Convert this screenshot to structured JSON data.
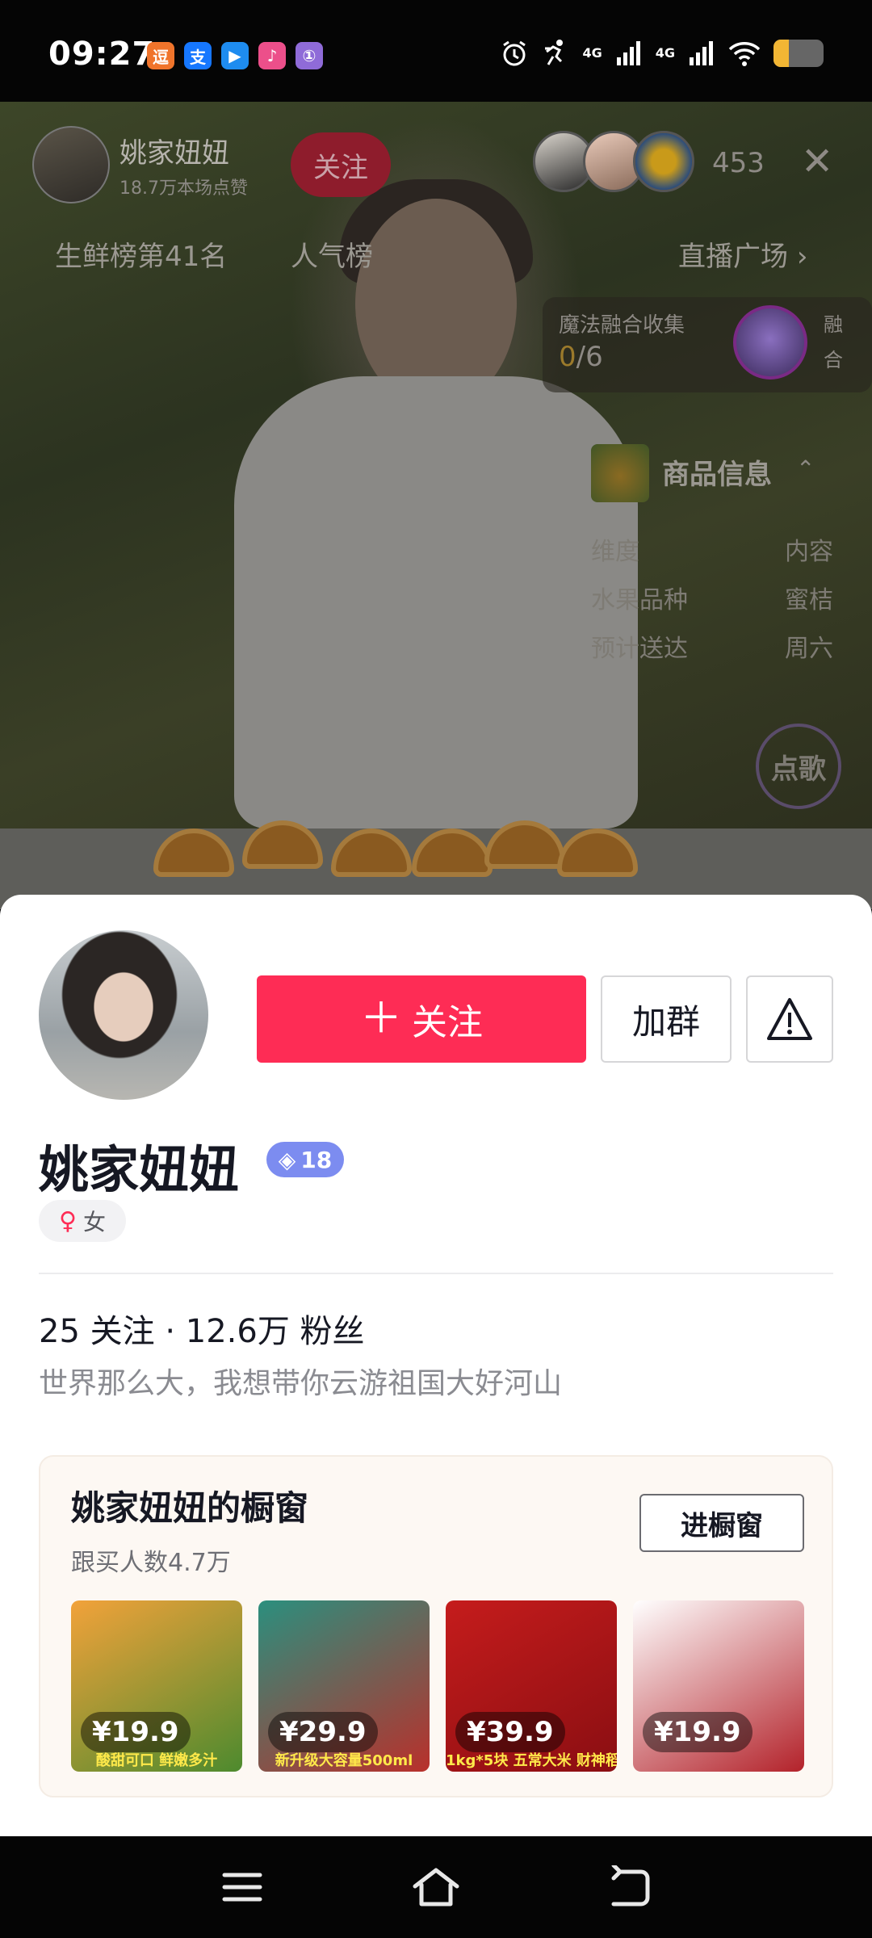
{
  "status_bar": {
    "time": "09:27",
    "notifications": [
      {
        "icon": "app-notification-icon",
        "glyph": "逗",
        "color": "#f0742b"
      },
      {
        "icon": "alipay-icon",
        "glyph": "支",
        "color": "#1677ff"
      },
      {
        "icon": "video-app-icon",
        "glyph": "▶",
        "color": "#1e8cf0"
      },
      {
        "icon": "music-app-icon",
        "glyph": "♪",
        "color": "#ec4f8a"
      },
      {
        "icon": "app-icon",
        "glyph": "①",
        "color": "#8f6bd8"
      }
    ],
    "network_1": "4G",
    "network_2": "4G",
    "battery_level": 0.3
  },
  "live": {
    "host_name": "姚家妞妞",
    "host_likes": "18.7万本场点赞",
    "follow_label": "关注",
    "viewer_count": "453",
    "rank_label": "生鲜榜第41名",
    "popularity_label": "人气榜",
    "plaza_label": "直播广场",
    "magic": {
      "title": "魔法融合收集",
      "current": "0",
      "total": "/6",
      "side_label": "融合"
    },
    "product": {
      "title": "商品信息",
      "rows": [
        {
          "key": "维度",
          "value": "内容"
        },
        {
          "key": "水果品种",
          "value": "蜜桔"
        },
        {
          "key": "预计送达",
          "value": "周六"
        }
      ]
    },
    "song_label": "点歌"
  },
  "profile": {
    "follow_button": "关注",
    "group_button": "加群",
    "name": "姚家妞妞",
    "level": "18",
    "gender": "女",
    "stats": "25 关注 · 12.6万 粉丝",
    "bio": "世界那么大，我想带你云游祖国大好河山"
  },
  "window": {
    "title": "姚家妞妞的橱窗",
    "subtitle": "跟买人数4.7万",
    "enter_button": "进橱窗",
    "goods": [
      {
        "price": "¥19.9",
        "caption": "酸甜可口 鲜嫩多汁",
        "colors": [
          "#f2a23a",
          "#4d8a2e"
        ]
      },
      {
        "price": "¥29.9",
        "caption": "新升级大容量500ml",
        "colors": [
          "#2b8f7e",
          "#b9302b"
        ]
      },
      {
        "price": "¥39.9",
        "caption": "1kg*5块 五常大米 财神稻",
        "colors": [
          "#c51c1c",
          "#8a0e12"
        ]
      },
      {
        "price": "¥19.9",
        "caption": "",
        "colors": [
          "#ffffff",
          "#b3222a"
        ]
      }
    ]
  },
  "nav": {
    "menu_icon": "menu-icon",
    "home_icon": "home-icon",
    "back_icon": "back-icon"
  }
}
